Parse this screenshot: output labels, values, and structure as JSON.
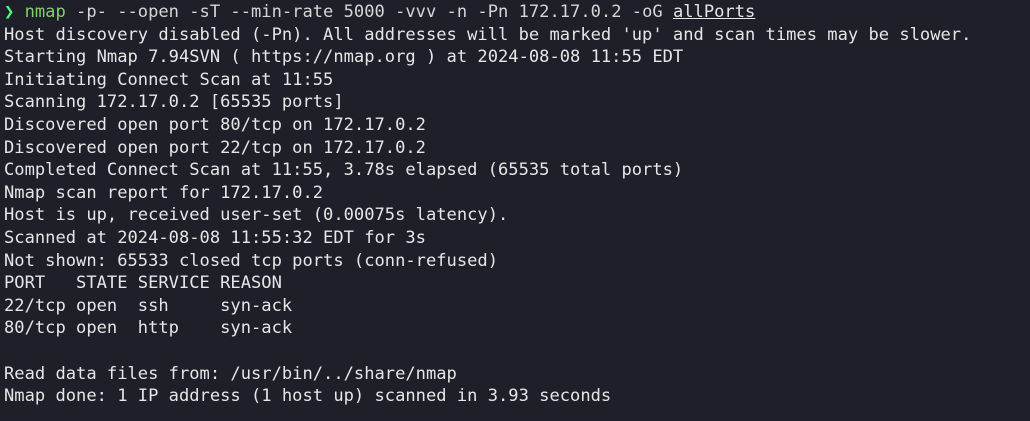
{
  "prompt": {
    "arrow": "❯",
    "command": "nmap",
    "args": " -p- --open -sT --min-rate 5000 -vvv -n -Pn 172.17.0.2 -oG ",
    "output_file": "allPorts"
  },
  "output": [
    "Host discovery disabled (-Pn). All addresses will be marked 'up' and scan times may be slower.",
    "Starting Nmap 7.94SVN ( https://nmap.org ) at 2024-08-08 11:55 EDT",
    "Initiating Connect Scan at 11:55",
    "Scanning 172.17.0.2 [65535 ports]",
    "Discovered open port 80/tcp on 172.17.0.2",
    "Discovered open port 22/tcp on 172.17.0.2",
    "Completed Connect Scan at 11:55, 3.78s elapsed (65535 total ports)",
    "Nmap scan report for 172.17.0.2",
    "Host is up, received user-set (0.00075s latency).",
    "Scanned at 2024-08-08 11:55:32 EDT for 3s",
    "Not shown: 65533 closed tcp ports (conn-refused)",
    "PORT   STATE SERVICE REASON",
    "22/tcp open  ssh     syn-ack",
    "80/tcp open  http    syn-ack",
    "",
    "Read data files from: /usr/bin/../share/nmap",
    "Nmap done: 1 IP address (1 host up) scanned in 3.93 seconds"
  ],
  "colors": {
    "background": "#1e1f29",
    "text": "#e6e6e6",
    "prompt_arrow": "#50fa7b",
    "command": "#82cf6a"
  }
}
